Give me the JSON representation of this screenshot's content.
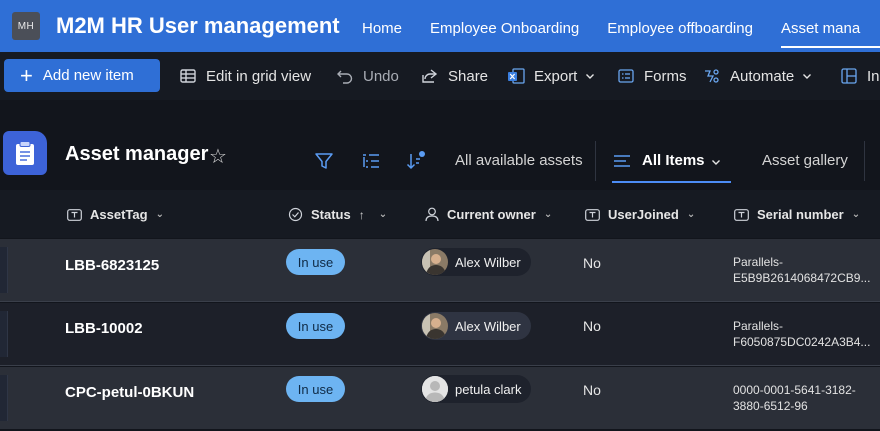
{
  "site": {
    "logo_initials": "MH",
    "title": "M2M HR User management",
    "nav": [
      "Home",
      "Employee Onboarding",
      "Employee offboarding",
      "Asset mana"
    ]
  },
  "commands": {
    "add_new": "Add new item",
    "edit_grid": "Edit in grid view",
    "undo": "Undo",
    "share": "Share",
    "export": "Export",
    "forms": "Forms",
    "automate": "Automate",
    "integrate": "In"
  },
  "list": {
    "title": "Asset manager",
    "views": [
      "All available assets",
      "All Items",
      "Asset gallery"
    ],
    "active_view": "All Items"
  },
  "columns": {
    "asset_tag": "AssetTag",
    "status": "Status",
    "owner": "Current owner",
    "user_joined": "UserJoined",
    "serial": "Serial number"
  },
  "rows": [
    {
      "asset_tag": "LBB-6823125",
      "status": "In use",
      "owner": "Alex Wilber",
      "user_joined": "No",
      "serial_line1": "Parallels-",
      "serial_line2": "E5B9B2614068472CB9..."
    },
    {
      "asset_tag": "LBB-10002",
      "status": "In use",
      "owner": "Alex Wilber",
      "user_joined": "No",
      "serial_line1": "Parallels-",
      "serial_line2": "F6050875DC0242A3B4..."
    },
    {
      "asset_tag": "CPC-petul-0BKUN",
      "status": "In use",
      "owner": "petula clark",
      "user_joined": "No",
      "serial_line1": "0000-0001-5641-3182-",
      "serial_line2": "3880-6512-96"
    }
  ],
  "colors": {
    "header_blue": "#2f6fd6",
    "status_pill": "#6db4f2",
    "background": "#12151c"
  }
}
